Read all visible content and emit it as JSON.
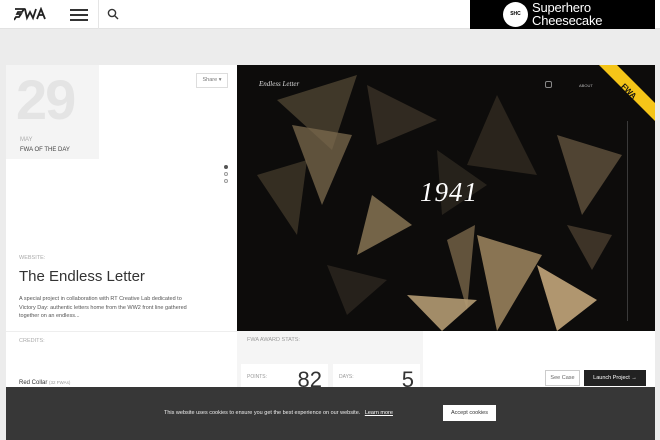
{
  "header": {
    "logo": "FWA",
    "ad": {
      "badge": "SHC",
      "line1": "Superhero",
      "line2": "Cheesecake"
    }
  },
  "fotd": {
    "day": "29",
    "month": "MAY",
    "label": "FWA OF THE DAY",
    "share_label": "Share ▾",
    "website_label": "WEBSITE:",
    "site_title": "The Endless Letter",
    "description": "A special project in collaboration with RT Creative Lab dedicated to Victory Day: authentic letters home from the WW2 front line gathered together on an endless..."
  },
  "hero": {
    "title": "Endless Letter",
    "about": "ABOUT",
    "year": "1941",
    "ribbon": "FWA"
  },
  "credits": {
    "label": "CREDITS:",
    "name": "Red Collar",
    "sub": "(32 FWAs)"
  },
  "stats": {
    "label": "FWA AWARD STATS:",
    "points_label": "POINTS:",
    "points": "82",
    "days_label": "DAYS:",
    "days": "5"
  },
  "actions": {
    "see_case": "See Case",
    "launch": "Launch Project →"
  },
  "cookie": {
    "text": "This website uses cookies to ensure you get the best experience on our website.",
    "learn_more": "Learn more",
    "accept": "Accept cookies"
  }
}
